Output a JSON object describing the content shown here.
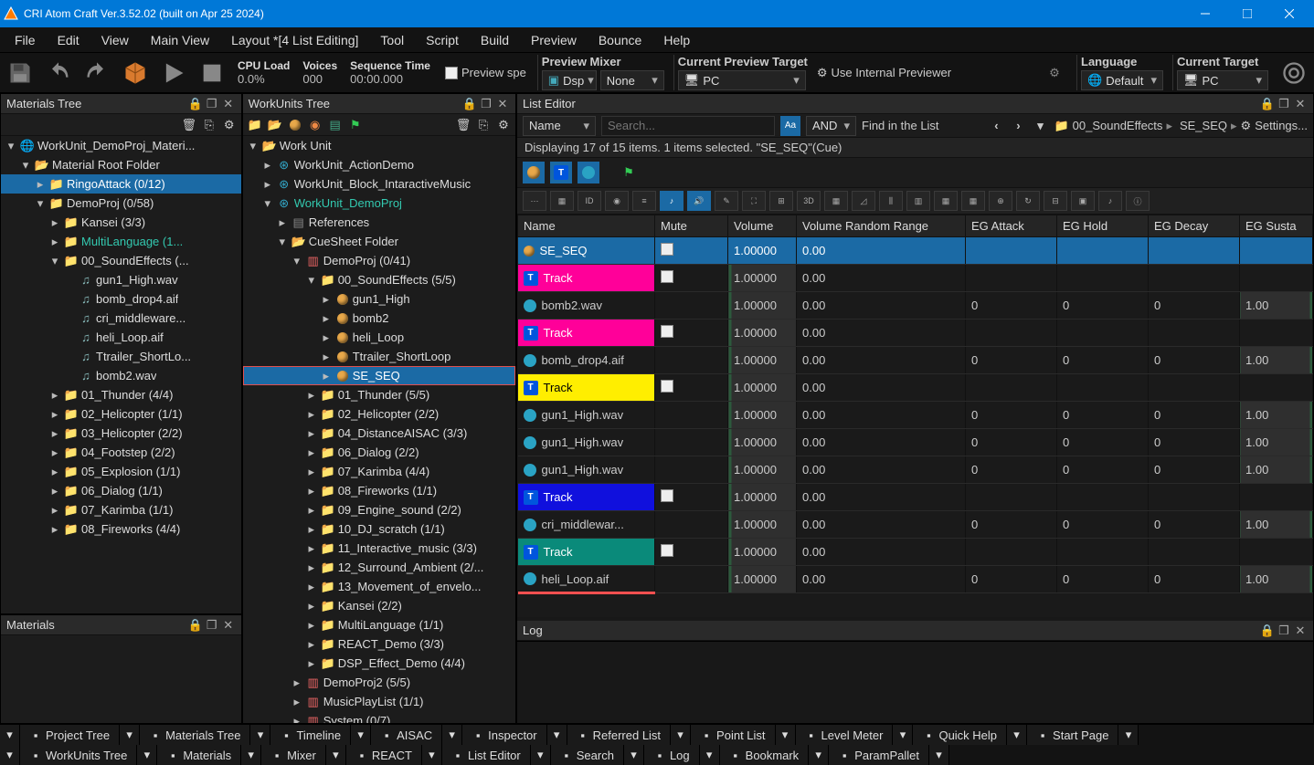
{
  "title": "CRI Atom Craft Ver.3.52.02 (built on Apr 25 2024)",
  "menu": [
    "File",
    "Edit",
    "View",
    "Main View",
    "Layout *[4 List Editing]",
    "Tool",
    "Script",
    "Build",
    "Preview",
    "Bounce",
    "Help"
  ],
  "toolbar": {
    "cpu_load_label": "CPU Load",
    "cpu_load_value": "0.0%",
    "voices_label": "Voices",
    "voices_value": "000",
    "seq_label": "Sequence Time",
    "seq_value": "00:00.000",
    "preview_spe": "Preview spe",
    "preview_mixer_label": "Preview Mixer",
    "dsp_label": "Dsp",
    "none_label": "None",
    "current_target_label": "Current Preview Target",
    "pc_label": "PC",
    "use_internal": "Use Internal Previewer",
    "language_label": "Language",
    "default_label": "Default",
    "current_target2_label": "Current Target",
    "pc2_label": "PC"
  },
  "materials_tree": {
    "title": "Materials Tree",
    "items": [
      {
        "depth": 0,
        "tw": "▾",
        "icon": "globe",
        "text": "WorkUnit_DemoProj_Materi..."
      },
      {
        "depth": 1,
        "tw": "▾",
        "icon": "folder-open",
        "text": "Material Root Folder"
      },
      {
        "depth": 2,
        "tw": "▸",
        "icon": "folder",
        "text": "RingoAttack (0/12)",
        "sel": true
      },
      {
        "depth": 2,
        "tw": "▾",
        "icon": "folder",
        "text": "DemoProj (0/58)"
      },
      {
        "depth": 3,
        "tw": "▸",
        "icon": "folder",
        "text": "Kansei (3/3)"
      },
      {
        "depth": 3,
        "tw": "▸",
        "icon": "folder",
        "text": "MultiLanguage (1...",
        "cls": "teal"
      },
      {
        "depth": 3,
        "tw": "▾",
        "icon": "folder",
        "text": "00_SoundEffects (..."
      },
      {
        "depth": 4,
        "tw": "",
        "icon": "wave",
        "text": "gun1_High.wav"
      },
      {
        "depth": 4,
        "tw": "",
        "icon": "wave",
        "text": "bomb_drop4.aif"
      },
      {
        "depth": 4,
        "tw": "",
        "icon": "wave",
        "text": "cri_middleware..."
      },
      {
        "depth": 4,
        "tw": "",
        "icon": "wave",
        "text": "heli_Loop.aif"
      },
      {
        "depth": 4,
        "tw": "",
        "icon": "wave",
        "text": "Ttrailer_ShortLo..."
      },
      {
        "depth": 4,
        "tw": "",
        "icon": "wave",
        "text": "bomb2.wav"
      },
      {
        "depth": 3,
        "tw": "▸",
        "icon": "folder",
        "text": "01_Thunder (4/4)"
      },
      {
        "depth": 3,
        "tw": "▸",
        "icon": "folder",
        "text": "02_Helicopter (1/1)"
      },
      {
        "depth": 3,
        "tw": "▸",
        "icon": "folder",
        "text": "03_Helicopter (2/2)"
      },
      {
        "depth": 3,
        "tw": "▸",
        "icon": "folder",
        "text": "04_Footstep (2/2)"
      },
      {
        "depth": 3,
        "tw": "▸",
        "icon": "folder",
        "text": "05_Explosion (1/1)"
      },
      {
        "depth": 3,
        "tw": "▸",
        "icon": "folder",
        "text": "06_Dialog (1/1)"
      },
      {
        "depth": 3,
        "tw": "▸",
        "icon": "folder",
        "text": "07_Karimba (1/1)"
      },
      {
        "depth": 3,
        "tw": "▸",
        "icon": "folder",
        "text": "08_Fireworks (4/4)"
      }
    ]
  },
  "materials_panel_title": "Materials",
  "workunits_tree": {
    "title": "WorkUnits Tree",
    "items": [
      {
        "depth": 0,
        "tw": "▾",
        "icon": "folder-open",
        "text": "Work Unit"
      },
      {
        "depth": 1,
        "tw": "▸",
        "icon": "wu",
        "text": "WorkUnit_ActionDemo"
      },
      {
        "depth": 1,
        "tw": "▸",
        "icon": "wu",
        "text": "WorkUnit_Block_IntaractiveMusic"
      },
      {
        "depth": 1,
        "tw": "▾",
        "icon": "wu",
        "text": "WorkUnit_DemoProj",
        "cls": "lime"
      },
      {
        "depth": 2,
        "tw": "▸",
        "icon": "ref",
        "text": "References"
      },
      {
        "depth": 2,
        "tw": "▾",
        "icon": "folder-open",
        "text": "CueSheet Folder"
      },
      {
        "depth": 3,
        "tw": "▾",
        "icon": "sheet",
        "text": "DemoProj (0/41)"
      },
      {
        "depth": 4,
        "tw": "▾",
        "icon": "folder",
        "text": "00_SoundEffects (5/5)"
      },
      {
        "depth": 5,
        "tw": "▸",
        "icon": "cue",
        "text": "gun1_High"
      },
      {
        "depth": 5,
        "tw": "▸",
        "icon": "cue",
        "text": "bomb2"
      },
      {
        "depth": 5,
        "tw": "▸",
        "icon": "cue",
        "text": "heli_Loop"
      },
      {
        "depth": 5,
        "tw": "▸",
        "icon": "cue",
        "text": "Ttrailer_ShortLoop"
      },
      {
        "depth": 5,
        "tw": "▸",
        "icon": "cue",
        "text": "SE_SEQ",
        "selbox": true
      },
      {
        "depth": 4,
        "tw": "▸",
        "icon": "folder",
        "text": "01_Thunder (5/5)"
      },
      {
        "depth": 4,
        "tw": "▸",
        "icon": "folder",
        "text": "02_Helicopter (2/2)"
      },
      {
        "depth": 4,
        "tw": "▸",
        "icon": "folder",
        "text": "04_DistanceAISAC (3/3)"
      },
      {
        "depth": 4,
        "tw": "▸",
        "icon": "folder",
        "text": "06_Dialog (2/2)"
      },
      {
        "depth": 4,
        "tw": "▸",
        "icon": "folder",
        "text": "07_Karimba (4/4)"
      },
      {
        "depth": 4,
        "tw": "▸",
        "icon": "folder",
        "text": "08_Fireworks (1/1)"
      },
      {
        "depth": 4,
        "tw": "▸",
        "icon": "folder",
        "text": "09_Engine_sound (2/2)"
      },
      {
        "depth": 4,
        "tw": "▸",
        "icon": "folder",
        "text": "10_DJ_scratch (1/1)"
      },
      {
        "depth": 4,
        "tw": "▸",
        "icon": "folder",
        "text": "11_Interactive_music (3/3)"
      },
      {
        "depth": 4,
        "tw": "▸",
        "icon": "folder",
        "text": "12_Surround_Ambient (2/..."
      },
      {
        "depth": 4,
        "tw": "▸",
        "icon": "folder",
        "text": "13_Movement_of_envelo..."
      },
      {
        "depth": 4,
        "tw": "▸",
        "icon": "folder",
        "text": "Kansei (2/2)"
      },
      {
        "depth": 4,
        "tw": "▸",
        "icon": "folder",
        "text": "MultiLanguage (1/1)"
      },
      {
        "depth": 4,
        "tw": "▸",
        "icon": "folder",
        "text": "REACT_Demo (3/3)"
      },
      {
        "depth": 4,
        "tw": "▸",
        "icon": "folder",
        "text": "DSP_Effect_Demo (4/4)"
      },
      {
        "depth": 3,
        "tw": "▸",
        "icon": "sheet",
        "text": "DemoProj2 (5/5)"
      },
      {
        "depth": 3,
        "tw": "▸",
        "icon": "sheet",
        "text": "MusicPlayList (1/1)"
      },
      {
        "depth": 3,
        "tw": "▸",
        "icon": "sheet",
        "text": "System (0/7)"
      }
    ]
  },
  "list_editor": {
    "title": "List Editor",
    "filter_field_label": "Name",
    "search_placeholder": "Search...",
    "and_label": "AND",
    "find_label": "Find in the List",
    "breadcrumb": [
      "00_SoundEffects",
      "SE_SEQ",
      "Settings..."
    ],
    "status": "Displaying 17 of 15 items. 1 items selected. \"SE_SEQ\"(Cue)",
    "columns": [
      "Name",
      "Mute",
      "Volume",
      "Volume Random Range",
      "EG Attack",
      "EG Hold",
      "EG Decay",
      "EG Susta"
    ],
    "rows": [
      {
        "name": "SE_SEQ",
        "type": "cue",
        "mute": true,
        "vol": "1.00000",
        "vrr": "0.00",
        "sel": true
      },
      {
        "name": "Track",
        "type": "track",
        "clr": "pink",
        "mute": true,
        "vol": "1.00000",
        "vrr": "0.00"
      },
      {
        "name": "bomb2.wav",
        "type": "wave",
        "vol": "1.00000",
        "vrr": "0.00",
        "eg": "0",
        "egs": "1.00"
      },
      {
        "name": "Track",
        "type": "track",
        "clr": "pink",
        "mute": true,
        "vol": "1.00000",
        "vrr": "0.00"
      },
      {
        "name": "bomb_drop4.aif",
        "type": "wave",
        "vol": "1.00000",
        "vrr": "0.00",
        "eg": "0",
        "egs": "1.00"
      },
      {
        "name": "Track",
        "type": "track",
        "clr": "yellow",
        "mute": true,
        "vol": "1.00000",
        "vrr": "0.00"
      },
      {
        "name": "gun1_High.wav",
        "type": "wave",
        "vol": "1.00000",
        "vrr": "0.00",
        "eg": "0",
        "egs": "1.00"
      },
      {
        "name": "gun1_High.wav",
        "type": "wave",
        "vol": "1.00000",
        "vrr": "0.00",
        "eg": "0",
        "egs": "1.00"
      },
      {
        "name": "gun1_High.wav",
        "type": "wave",
        "vol": "1.00000",
        "vrr": "0.00",
        "eg": "0",
        "egs": "1.00"
      },
      {
        "name": "Track",
        "type": "track",
        "clr": "blue",
        "mute": true,
        "vol": "1.00000",
        "vrr": "0.00"
      },
      {
        "name": "cri_middlewar...",
        "type": "wave",
        "vol": "1.00000",
        "vrr": "0.00",
        "eg": "0",
        "egs": "1.00"
      },
      {
        "name": "Track",
        "type": "track",
        "clr": "teal",
        "mute": true,
        "vol": "1.00000",
        "vrr": "0.00"
      },
      {
        "name": "heli_Loop.aif",
        "type": "wave",
        "vol": "1.00000",
        "vrr": "0.00",
        "eg": "0",
        "egs": "1.00",
        "lastred": true
      }
    ]
  },
  "log_title": "Log",
  "bottom_tabs_row1": [
    "Project Tree",
    "Materials Tree",
    "Timeline",
    "AISAC",
    "Inspector",
    "Referred List",
    "Point List",
    "Level Meter",
    "Quick Help",
    "Start Page"
  ],
  "bottom_tabs_row2": [
    "WorkUnits Tree",
    "Materials",
    "Mixer",
    "REACT",
    "List Editor",
    "Search",
    "Log",
    "Bookmark",
    "ParamPallet"
  ]
}
